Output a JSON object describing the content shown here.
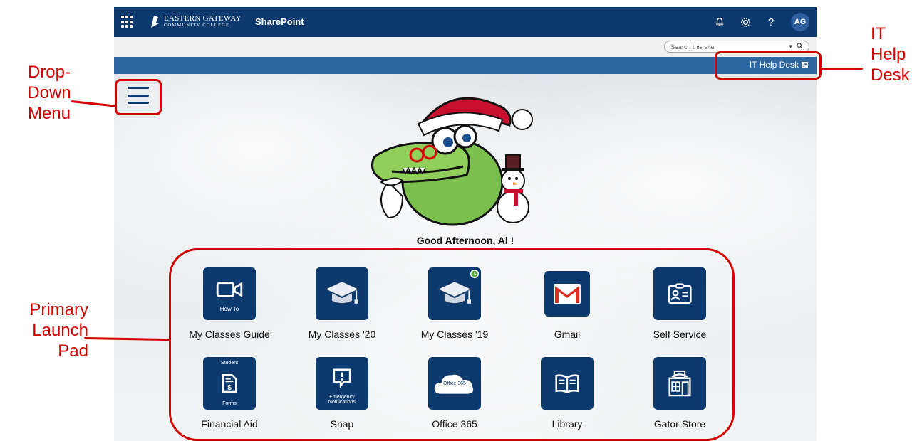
{
  "suitebar": {
    "logo_line1": "Eastern Gateway",
    "logo_line2": "Community College",
    "app_name": "SharePoint",
    "avatar_initials": "AG",
    "help_glyph": "?",
    "icons": [
      "waffle-icon",
      "bell-icon",
      "gear-icon",
      "help-icon"
    ],
    "color": "#0d3a6e"
  },
  "search": {
    "placeholder": "Search this site"
  },
  "navbar": {
    "help_desk_label": "IT Help Desk",
    "color": "#2f67a0"
  },
  "main": {
    "greeting": "Good Afternoon, Al !"
  },
  "tiles": [
    {
      "label": "My Classes Guide",
      "icon": "video-camera-icon",
      "caption": "How To"
    },
    {
      "label": "My Classes '20",
      "icon": "graduation-cap-icon"
    },
    {
      "label": "My Classes '19",
      "icon": "graduation-cap-clock-icon"
    },
    {
      "label": "Gmail",
      "icon": "gmail-icon"
    },
    {
      "label": "Self Service",
      "icon": "id-card-icon"
    },
    {
      "label": "Financial Aid",
      "icon": "dollar-form-icon",
      "caption_top": "Student",
      "caption": "Forms"
    },
    {
      "label": "Snap",
      "icon": "alert-bubble-icon",
      "caption": "Emergency Notifications"
    },
    {
      "label": "Office 365",
      "icon": "office-cloud-icon",
      "caption": "Office 365"
    },
    {
      "label": "Library",
      "icon": "open-book-icon"
    },
    {
      "label": "Gator Store",
      "icon": "store-icon"
    }
  ],
  "annotations": {
    "dropdown_menu": [
      "Drop-",
      "Down",
      "Menu"
    ],
    "primary_launch_pad": [
      "Primary",
      "Launch",
      "Pad"
    ],
    "it_help_desk": [
      "IT",
      "Help",
      "Desk"
    ],
    "color": "#d40000"
  }
}
